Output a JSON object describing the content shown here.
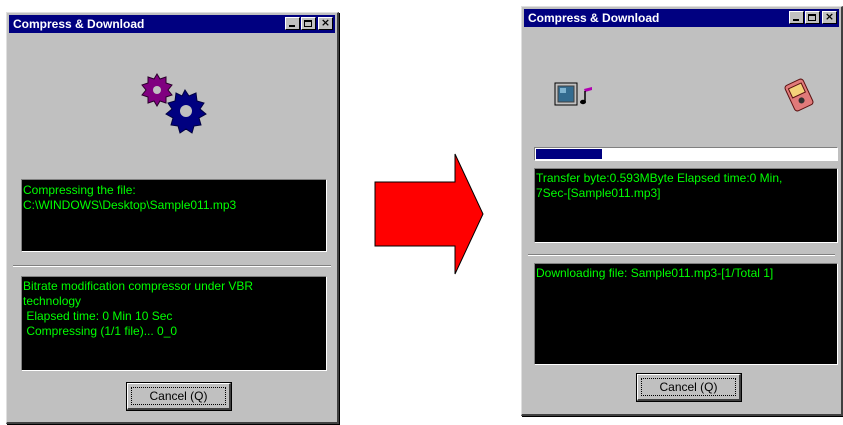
{
  "window_compress": {
    "title": "Compress & Download",
    "icon": "gears-icon",
    "status_lines": [
      "Compressing the file:",
      "C:\\WINDOWS\\Desktop\\Sample011.mp3"
    ],
    "info_lines": [
      "Bitrate modification compressor under VBR",
      "technology",
      " Elapsed time: 0 Min 10 Sec",
      " Compressing (1/1 file)... 0_0"
    ],
    "cancel_label": "Cancel (Q)"
  },
  "window_download": {
    "title": "Compress & Download",
    "progress": 0.22,
    "status_lines": [
      "Transfer byte:0.593MByte Elapsed time:0 Min,",
      "7Sec-[Sample011.mp3]"
    ],
    "info_lines": [
      "Downloading file: Sample011.mp3-[1/Total 1]"
    ],
    "cancel_label": "Cancel (Q)"
  },
  "colors": {
    "titlebar": "#000080",
    "console_bg": "#000000",
    "console_text": "#00ff00",
    "arrow": "#ff0000"
  }
}
